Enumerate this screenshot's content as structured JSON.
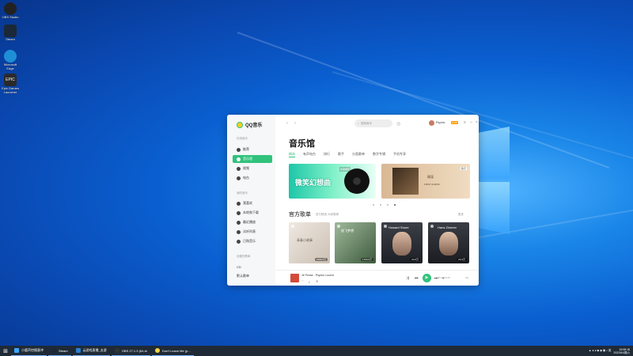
{
  "desktop": {
    "icons": [
      {
        "label": "OBS Studio",
        "name": "obs-icon",
        "color": "#222222"
      },
      {
        "label": "Steam",
        "name": "steam-icon",
        "color": "#1b2838"
      },
      {
        "label": "Microsoft Edge",
        "name": "edge-icon",
        "color": "#1e8fd6"
      },
      {
        "label": "Epic Games Launcher",
        "name": "epic-icon",
        "color": "#2a2a2a"
      }
    ]
  },
  "app": {
    "logo": "QQ音乐",
    "sidebar": {
      "section_online": "在线音乐",
      "items_online": [
        {
          "label": "推荐",
          "icon": "compass-icon"
        },
        {
          "label": "音乐馆",
          "icon": "music-hall-icon"
        },
        {
          "label": "视频",
          "icon": "video-icon"
        },
        {
          "label": "电台",
          "icon": "radio-icon"
        }
      ],
      "section_mine": "我的音乐",
      "items_mine": [
        {
          "label": "我喜欢",
          "icon": "heart-icon"
        },
        {
          "label": "本地和下载",
          "icon": "download-icon"
        },
        {
          "label": "最近播放",
          "icon": "history-icon"
        },
        {
          "label": "试听列表",
          "icon": "list-icon"
        },
        {
          "label": "已购音乐",
          "icon": "purchased-icon"
        }
      ],
      "section_created": "创建的歌单",
      "items_created": [
        {
          "label": "CD"
        },
        {
          "label": "默认歌单"
        }
      ]
    },
    "topbar": {
      "search_placeholder": "搜索音乐",
      "user_name": "Psycho",
      "vip": "SVIP"
    },
    "page_title": "音乐馆",
    "tabs": [
      "精选",
      "有声电台",
      "排行",
      "歌手",
      "分类歌单",
      "数字专辑",
      "手机专享"
    ],
    "banners": [
      {
        "title": "微笑幻想曲",
        "sticker": "新歌推荐"
      },
      {
        "name": "周深",
        "sub": "FIRST ALBUM",
        "tag": "数字"
      }
    ],
    "section": {
      "title": "官方歌单",
      "subtitle": "官方精选·为你推荐",
      "more": "更多"
    },
    "cards": [
      {
        "title": "青春小故事",
        "count": "2189.6万"
      },
      {
        "title": "放飞梦想",
        "count": "1700.0万"
      },
      {
        "title": "Howard Shore",
        "count": "24.6万"
      },
      {
        "title": "Hans Zimmer",
        "count": "26.3万"
      }
    ],
    "player": {
      "song": "Je Pense - Psycho Lucent",
      "time": "00:00/03:29",
      "quality": "SQ"
    }
  },
  "taskbar": {
    "items": [
      {
        "label": "小鹿声控随意冲",
        "color": "#3aa6ff"
      },
      {
        "label": "Steam",
        "color": "#1b2838"
      },
      {
        "label": "云游戏直播_去游",
        "color": "#2b7fd3"
      },
      {
        "label": "OBS 27.1.3 (64-bi",
        "color": "#333333"
      },
      {
        "label": "Don't Leave Me (p...",
        "color": "#f3d34a"
      }
    ],
    "time": "15:08:18",
    "date": "2022/6/4周六"
  }
}
